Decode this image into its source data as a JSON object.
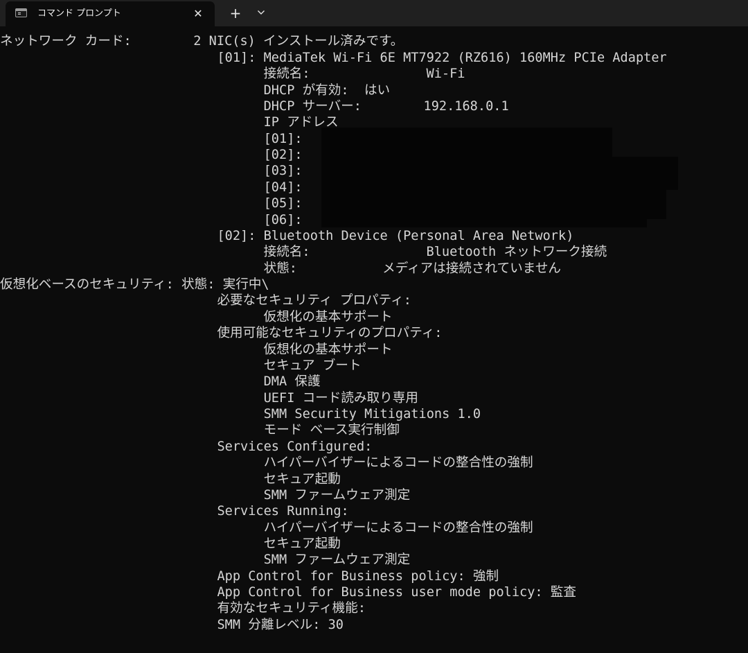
{
  "window": {
    "tab_title": "コマンド プロンプト",
    "tab_close_glyph": "✕",
    "new_tab_glyph": "+",
    "icons": [
      "console-icon",
      "close-icon",
      "plus-icon",
      "chevron-down-icon"
    ]
  },
  "colors": {
    "background": "#0c0c0c",
    "titlebar": "#202020",
    "text": "#d6d6d6"
  },
  "console": {
    "lines": [
      "ネットワーク カード:        2 NIC(s) インストール済みです。",
      "                            [01]: MediaTek Wi-Fi 6E MT7922 (RZ616) 160MHz PCIe Adapter",
      "                                  接続名:               Wi-Fi",
      "                                  DHCP が有効:  はい",
      "                                  DHCP サーバー:        192.168.0.1",
      "                                  IP アドレス",
      "                                  [01]:",
      "                                  [02]:",
      "                                  [03]:",
      "                                  [04]:",
      "                                  [05]:",
      "                                  [06]:",
      "                            [02]: Bluetooth Device (Personal Area Network)",
      "                                  接続名:               Bluetooth ネットワーク接続",
      "                                  状態:           メディアは接続されていません",
      "仮想化ベースのセキュリティ: 状態: 実行中\\",
      "                            必要なセキュリティ プロパティ:",
      "                                  仮想化の基本サポート",
      "                            使用可能なセキュリティのプロパティ:",
      "                                  仮想化の基本サポート",
      "                                  セキュア ブート",
      "                                  DMA 保護",
      "                                  UEFI コード読み取り専用",
      "                                  SMM Security Mitigations 1.0",
      "                                  モード ベース実行制御",
      "                            Services Configured:",
      "                                  ハイパーバイザーによるコードの整合性の強制",
      "                                  セキュア起動",
      "                                  SMM ファームウェア測定",
      "                            Services Running:",
      "                                  ハイパーバイザーによるコードの整合性の強制",
      "                                  セキュア起動",
      "                                  SMM ファームウェア測定",
      "                            App Control for Business policy: 強制",
      "                            App Control for Business user mode policy: 監査",
      "                            有効なセキュリティ機能:",
      "                            SMM 分離レベル: 30"
    ]
  }
}
